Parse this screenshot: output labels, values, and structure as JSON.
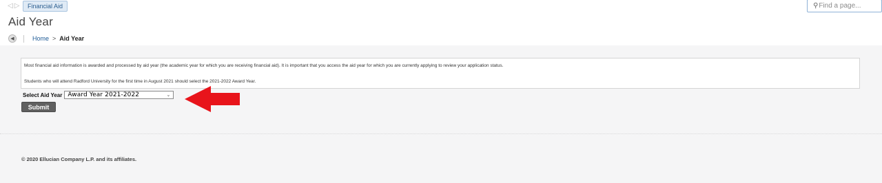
{
  "topbar": {
    "back_arrow": "◁",
    "forward_arrow": "▷",
    "app_tab_label": "Financial Aid",
    "find_placeholder": "Find a page..."
  },
  "page": {
    "title": "Aid Year"
  },
  "breadcrumb": {
    "home": "Home",
    "separator": ">",
    "current": "Aid Year"
  },
  "info": {
    "line1": "Most financial aid information is awarded and processed by aid year (the academic year for which you are receiving financial aid). It is important that you access the aid year for which you are currently applying to review your application status.",
    "line2": "Students who will attend Radford University for the first time in August 2021 should select the 2021-2022 Award Year."
  },
  "form": {
    "select_label": "Select Aid Year",
    "selected_value": "Award Year 2021-2022",
    "submit_label": "Submit"
  },
  "annotation": {
    "arrow_color": "#e8141b"
  },
  "footer": {
    "copyright": "© 2020 Ellucian Company L.P. and its affiliates."
  }
}
